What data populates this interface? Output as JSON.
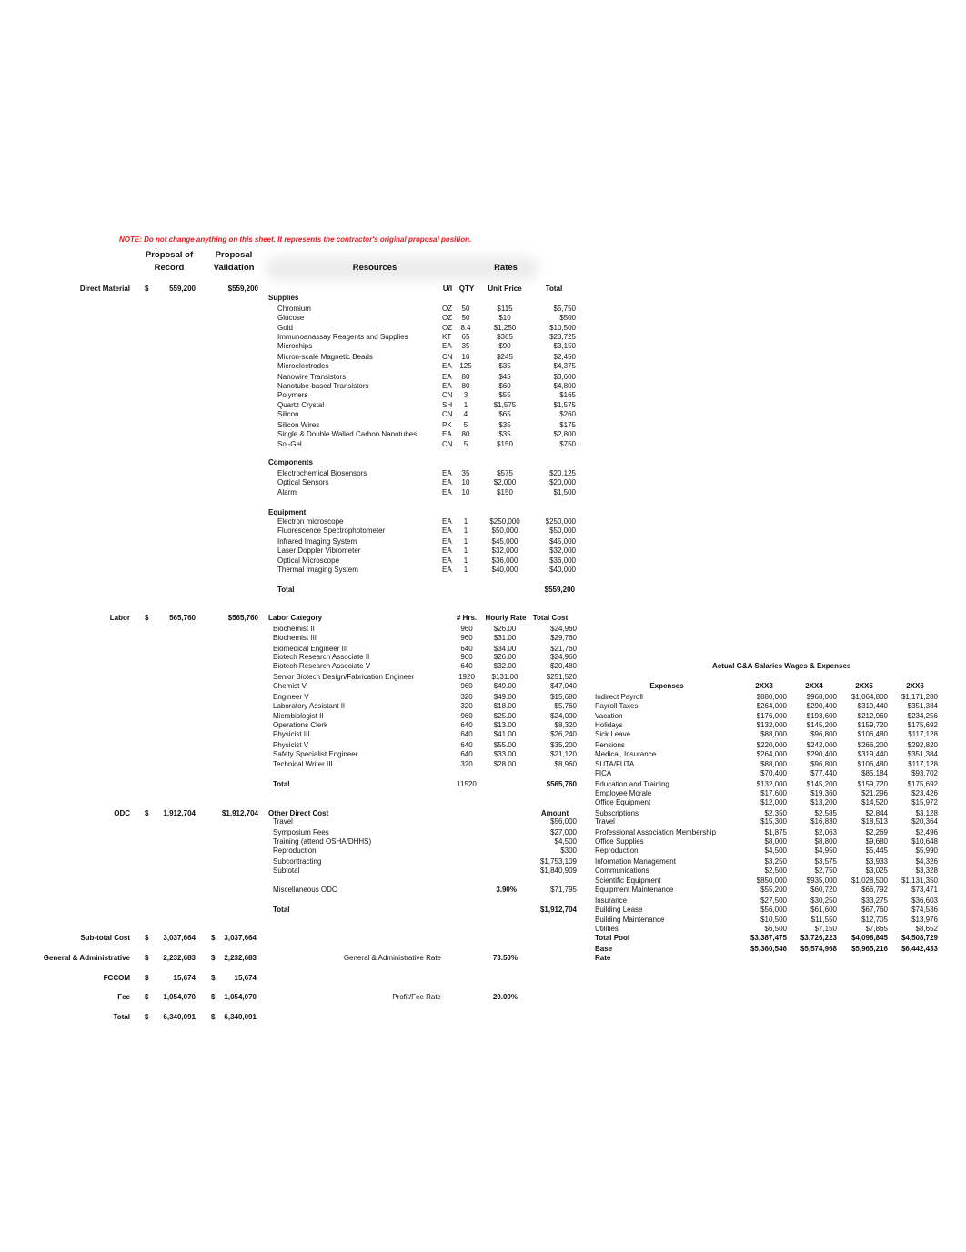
{
  "note": "NOTE: Do not change anything on this sheet. It represents the contractor's original proposal position.",
  "headers": {
    "proposal_of_record_1": "Proposal of",
    "proposal_of_record_2": "Record",
    "proposal_validation_1": "Proposal",
    "proposal_validation_2": "Validation",
    "resources": "Resources",
    "rates": "Rates"
  },
  "summary": {
    "direct_material": {
      "label": "Direct Material",
      "cur": "$",
      "record": "559,200",
      "validation": "$559,200"
    },
    "labor": {
      "label": "Labor",
      "cur": "$",
      "record": "565,760",
      "validation": "$565,760"
    },
    "odc": {
      "label": "ODC",
      "cur": "$",
      "record": "1,912,704",
      "validation": "$1,912,704"
    },
    "subtotal": {
      "label": "Sub-total Cost",
      "cur": "$",
      "record": "3,037,664",
      "cur2": "$",
      "validation": "3,037,664"
    },
    "ga": {
      "label": "General & Administrative",
      "cur": "$",
      "record": "2,232,683",
      "cur2": "$",
      "validation": "2,232,683",
      "rate_label": "General & Administrative Rate",
      "rate": "73.50%"
    },
    "fccom": {
      "label": "FCCOM",
      "cur": "$",
      "record": "15,674",
      "cur2": "$",
      "validation": "15,674"
    },
    "fee": {
      "label": "Fee",
      "cur": "$",
      "record": "1,054,070",
      "cur2": "$",
      "validation": "1,054,070",
      "rate_label": "Profit/Fee Rate",
      "rate": "20.00%"
    },
    "total": {
      "label": "Total",
      "cur": "$",
      "record": "6,340,091",
      "cur2": "$",
      "validation": "6,340,091"
    }
  },
  "materials": {
    "columns": {
      "ui": "U/I",
      "qty": "QTY",
      "unit_price": "Unit Price",
      "total": "Total"
    },
    "supplies_label": "Supplies",
    "supplies": [
      {
        "name": "Chromium",
        "ui": "OZ",
        "qty": "50",
        "price": "$115",
        "total": "$5,750"
      },
      {
        "name": "Glucose",
        "ui": "OZ",
        "qty": "50",
        "price": "$10",
        "total": "$500"
      },
      {
        "name": "Gold",
        "ui": "OZ",
        "qty": "8.4",
        "price": "$1,250",
        "total": "$10,500"
      },
      {
        "name": "Immunoanassay Reagents and Supplies",
        "ui": "KT",
        "qty": "65",
        "price": "$365",
        "total": "$23,725"
      },
      {
        "name": "Microchips",
        "ui": "EA",
        "qty": "35",
        "price": "$90",
        "total": "$3,150"
      },
      {
        "name": "Micron-scale Magnetic Beads",
        "ui": "CN",
        "qty": "10",
        "price": "$245",
        "total": "$2,450"
      },
      {
        "name": "Microelectrodes",
        "ui": "EA",
        "qty": "125",
        "price": "$35",
        "total": "$4,375"
      },
      {
        "name": "Nanowire Transistors",
        "ui": "EA",
        "qty": "80",
        "price": "$45",
        "total": "$3,600"
      },
      {
        "name": "Nanotube-based Transistors",
        "ui": "EA",
        "qty": "80",
        "price": "$60",
        "total": "$4,800"
      },
      {
        "name": "Polymers",
        "ui": "CN",
        "qty": "3",
        "price": "$55",
        "total": "$165"
      },
      {
        "name": "Quartz Crystal",
        "ui": "SH",
        "qty": "1",
        "price": "$1,575",
        "total": "$1,575"
      },
      {
        "name": "Silicon",
        "ui": "CN",
        "qty": "4",
        "price": "$65",
        "total": "$260"
      },
      {
        "name": "Silicon Wires",
        "ui": "PK",
        "qty": "5",
        "price": "$35",
        "total": "$175"
      },
      {
        "name": "Single & Double Walled Carbon Nanotubes",
        "ui": "EA",
        "qty": "80",
        "price": "$35",
        "total": "$2,800"
      },
      {
        "name": "Sol-Gel",
        "ui": "CN",
        "qty": "5",
        "price": "$150",
        "total": "$750"
      }
    ],
    "components_label": "Components",
    "components": [
      {
        "name": "Electrochemical Biosensors",
        "ui": "EA",
        "qty": "35",
        "price": "$575",
        "total": "$20,125"
      },
      {
        "name": "Optical Sensors",
        "ui": "EA",
        "qty": "10",
        "price": "$2,000",
        "total": "$20,000"
      },
      {
        "name": "Alarm",
        "ui": "EA",
        "qty": "10",
        "price": "$150",
        "total": "$1,500"
      }
    ],
    "equipment_label": "Equipment",
    "equipment": [
      {
        "name": "Electron microscope",
        "ui": "EA",
        "qty": "1",
        "price": "$250,000",
        "total": "$250,000"
      },
      {
        "name": "Fluorescence Spectrophotometer",
        "ui": "EA",
        "qty": "1",
        "price": "$50,000",
        "total": "$50,000"
      },
      {
        "name": "Infrared Imaging System",
        "ui": "EA",
        "qty": "1",
        "price": "$45,000",
        "total": "$45,000"
      },
      {
        "name": "Laser Doppler Vibrometer",
        "ui": "EA",
        "qty": "1",
        "price": "$32,000",
        "total": "$32,000"
      },
      {
        "name": "Optical Microscope",
        "ui": "EA",
        "qty": "1",
        "price": "$36,000",
        "total": "$36,000"
      },
      {
        "name": "Thermal Imaging System",
        "ui": "EA",
        "qty": "1",
        "price": "$40,000",
        "total": "$40,000"
      }
    ],
    "total_label": "Total",
    "total": "$559,200"
  },
  "labor": {
    "columns": {
      "category": "Labor Category",
      "hrs": "# Hrs.",
      "rate": "Hourly Rate",
      "cost": "Total Cost"
    },
    "rows": [
      {
        "name": "Biochemist II",
        "hrs": "960",
        "rate": "$26.00",
        "cost": "$24,960"
      },
      {
        "name": "Biochemist III",
        "hrs": "960",
        "rate": "$31.00",
        "cost": "$29,760"
      },
      {
        "name": "Biomedical Engineer III",
        "hrs": "640",
        "rate": "$34.00",
        "cost": "$21,760"
      },
      {
        "name": "Biotech Research Associate II",
        "hrs": "960",
        "rate": "$26.00",
        "cost": "$24,960"
      },
      {
        "name": "Biotech Research Associate V",
        "hrs": "640",
        "rate": "$32.00",
        "cost": "$20,480"
      },
      {
        "name": "Senior Biotech Design/Fabrication Engineer",
        "hrs": "1920",
        "rate": "$131.00",
        "cost": "$251,520"
      },
      {
        "name": "Chemist V",
        "hrs": "960",
        "rate": "$49.00",
        "cost": "$47,040"
      },
      {
        "name": "Engineer V",
        "hrs": "320",
        "rate": "$49.00",
        "cost": "$15,680"
      },
      {
        "name": "Laboratory Assistant II",
        "hrs": "320",
        "rate": "$18.00",
        "cost": "$5,760"
      },
      {
        "name": "Microbiologist II",
        "hrs": "960",
        "rate": "$25.00",
        "cost": "$24,000"
      },
      {
        "name": "Operations Clerk",
        "hrs": "640",
        "rate": "$13.00",
        "cost": "$8,320"
      },
      {
        "name": "Physicist III",
        "hrs": "640",
        "rate": "$41.00",
        "cost": "$26,240"
      },
      {
        "name": "Physicist V",
        "hrs": "640",
        "rate": "$55.00",
        "cost": "$35,200"
      },
      {
        "name": "Safety Specialist Engineer",
        "hrs": "640",
        "rate": "$33.00",
        "cost": "$21,120"
      },
      {
        "name": "Technical Writer III",
        "hrs": "320",
        "rate": "$28.00",
        "cost": "$8,960"
      }
    ],
    "total_label": "Total",
    "total_hrs": "11520",
    "total_cost": "$565,760"
  },
  "odc": {
    "header": "Other Direct Cost",
    "amount_header": "Amount",
    "rows": [
      {
        "name": "Travel",
        "amount": "$56,000"
      },
      {
        "name": "Symposium Fees",
        "amount": "$27,000"
      },
      {
        "name": "Training (attend OSHA/DHHS)",
        "amount": "$4,500"
      },
      {
        "name": "Reproduction",
        "amount": "$300"
      },
      {
        "name": "Subcontracting",
        "amount": "$1,753,109"
      },
      {
        "name": "Subtotal",
        "amount": "$1,840,909"
      }
    ],
    "misc_label": "Miscellaneous ODC",
    "misc_rate": "3.90%",
    "misc_amount": "$71,795",
    "total_label": "Total",
    "total": "$1,912,704"
  },
  "ga_table": {
    "title": "Actual G&A Salaries Wages & Expenses",
    "expenses_header": "Expenses",
    "years": [
      "2XX3",
      "2XX4",
      "2XX5",
      "2XX6"
    ],
    "rows": [
      {
        "name": "Indirect Payroll",
        "v": [
          "$880,000",
          "$968,000",
          "$1,064,800",
          "$1,171,280"
        ]
      },
      {
        "name": "Payroll Taxes",
        "v": [
          "$264,000",
          "$290,400",
          "$319,440",
          "$351,384"
        ]
      },
      {
        "name": "Vacation",
        "v": [
          "$176,000",
          "$193,600",
          "$212,960",
          "$234,256"
        ]
      },
      {
        "name": "Holidays",
        "v": [
          "$132,000",
          "$145,200",
          "$159,720",
          "$175,692"
        ]
      },
      {
        "name": "Sick Leave",
        "v": [
          "$88,000",
          "$96,800",
          "$106,480",
          "$117,128"
        ]
      },
      {
        "name": "Pensions",
        "v": [
          "$220,000",
          "$242,000",
          "$266,200",
          "$292,820"
        ]
      },
      {
        "name": "Medical, Insurance",
        "v": [
          "$264,000",
          "$290,400",
          "$319,440",
          "$351,384"
        ]
      },
      {
        "name": "SUTA/FUTA",
        "v": [
          "$88,000",
          "$96,800",
          "$106,480",
          "$117,128"
        ]
      },
      {
        "name": "FICA",
        "v": [
          "$70,400",
          "$77,440",
          "$85,184",
          "$93,702"
        ]
      },
      {
        "name": "Education and Training",
        "v": [
          "$132,000",
          "$145,200",
          "$159,720",
          "$175,692"
        ]
      },
      {
        "name": "Employee Morale",
        "v": [
          "$17,600",
          "$19,360",
          "$21,296",
          "$23,426"
        ]
      },
      {
        "name": "Office Equipment",
        "v": [
          "$12,000",
          "$13,200",
          "$14,520",
          "$15,972"
        ]
      },
      {
        "name": "Subscriptions",
        "v": [
          "$2,350",
          "$2,585",
          "$2,844",
          "$3,128"
        ]
      },
      {
        "name": "Travel",
        "v": [
          "$15,300",
          "$16,830",
          "$18,513",
          "$20,364"
        ]
      },
      {
        "name": "Professional Association Membership",
        "v": [
          "$1,875",
          "$2,063",
          "$2,269",
          "$2,496"
        ]
      },
      {
        "name": "Office Supplies",
        "v": [
          "$8,000",
          "$8,800",
          "$9,680",
          "$10,648"
        ]
      },
      {
        "name": "Reproduction",
        "v": [
          "$4,500",
          "$4,950",
          "$5,445",
          "$5,990"
        ]
      },
      {
        "name": "Information Management",
        "v": [
          "$3,250",
          "$3,575",
          "$3,933",
          "$4,326"
        ]
      },
      {
        "name": "Communications",
        "v": [
          "$2,500",
          "$2,750",
          "$3,025",
          "$3,328"
        ]
      },
      {
        "name": "Scientific Equipment",
        "v": [
          "$850,000",
          "$935,000",
          "$1,028,500",
          "$1,131,350"
        ]
      },
      {
        "name": "Equipment Maintenance",
        "v": [
          "$55,200",
          "$60,720",
          "$66,792",
          "$73,471"
        ]
      },
      {
        "name": "Insurance",
        "v": [
          "$27,500",
          "$30,250",
          "$33,275",
          "$36,603"
        ]
      },
      {
        "name": "Building Lease",
        "v": [
          "$56,000",
          "$61,600",
          "$67,760",
          "$74,536"
        ]
      },
      {
        "name": "Building Maintenance",
        "v": [
          "$10,500",
          "$11,550",
          "$12,705",
          "$13,976"
        ]
      },
      {
        "name": "Utilities",
        "v": [
          "$6,500",
          "$7,150",
          "$7,865",
          "$8,652"
        ]
      }
    ],
    "total_pool": {
      "name": "Total Pool",
      "v": [
        "$3,387,475",
        "$3,726,223",
        "$4,098,845",
        "$4,508,729"
      ]
    },
    "base": {
      "name": "Base",
      "v": [
        "$5,360,546",
        "$5,574,968",
        "$5,965,216",
        "$6,442,433"
      ]
    },
    "rate_label": "Rate"
  }
}
